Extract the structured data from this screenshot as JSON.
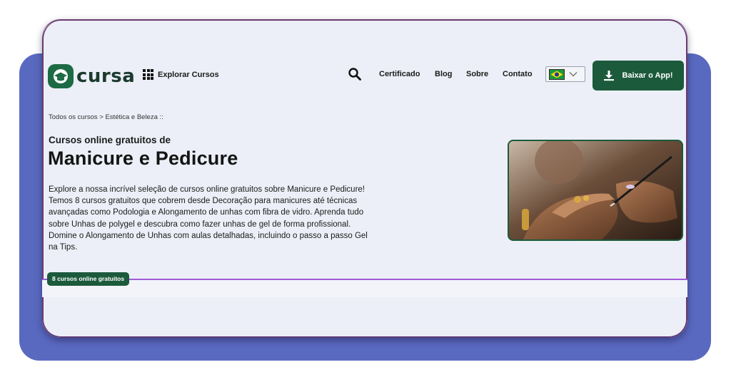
{
  "header": {
    "logo_text": "cursa",
    "explore_label": "Explorar Cursos",
    "nav": {
      "certificado": "Certificado",
      "blog": "Blog",
      "sobre": "Sobre",
      "contato": "Contato"
    },
    "language_icon": "brazil-flag-icon",
    "app_button_label": "Baixar o App!",
    "brand_color": "#1c5a3c"
  },
  "breadcrumb": "Todos os cursos > Estética e Beleza ::",
  "page": {
    "subtitle": "Cursos online gratuitos de",
    "title": "Manicure e Pedicure",
    "description": "Explore a nossa incrível seleção de cursos online gratuitos sobre Manicure e Pedicure! Temos 8 cursos gratuitos que cobrem desde Decoração para manicures até técnicas avançadas como Podologia e Alongamento de unhas com fibra de vidro. Aprenda tudo sobre Unhas de polygel e descubra como fazer unhas de gel de forma profissional. Domine o Alongamento de Unhas com aulas detalhadas, incluindo o passo a passo Gel na Tips.",
    "course_count_badge": "8 cursos online gratuitos"
  },
  "colors": {
    "backdrop": "#5a69c0",
    "card": "#eceff7",
    "accent_line": "#a35ad6"
  }
}
